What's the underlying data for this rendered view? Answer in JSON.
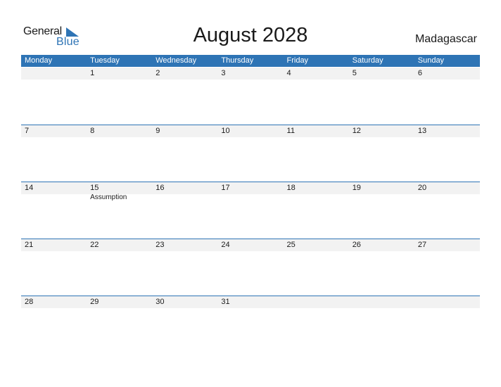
{
  "logo": {
    "general": "General",
    "blue": "Blue"
  },
  "title": "August 2028",
  "country": "Madagascar",
  "colors": {
    "accent": "#2e74b5",
    "stripe": "#f2f2f2"
  },
  "weekdays": [
    "Monday",
    "Tuesday",
    "Wednesday",
    "Thursday",
    "Friday",
    "Saturday",
    "Sunday"
  ],
  "weeks": [
    {
      "days": [
        {
          "num": "",
          "holiday": ""
        },
        {
          "num": "1",
          "holiday": ""
        },
        {
          "num": "2",
          "holiday": ""
        },
        {
          "num": "3",
          "holiday": ""
        },
        {
          "num": "4",
          "holiday": ""
        },
        {
          "num": "5",
          "holiday": ""
        },
        {
          "num": "6",
          "holiday": ""
        }
      ]
    },
    {
      "days": [
        {
          "num": "7",
          "holiday": ""
        },
        {
          "num": "8",
          "holiday": ""
        },
        {
          "num": "9",
          "holiday": ""
        },
        {
          "num": "10",
          "holiday": ""
        },
        {
          "num": "11",
          "holiday": ""
        },
        {
          "num": "12",
          "holiday": ""
        },
        {
          "num": "13",
          "holiday": ""
        }
      ]
    },
    {
      "days": [
        {
          "num": "14",
          "holiday": ""
        },
        {
          "num": "15",
          "holiday": "Assumption"
        },
        {
          "num": "16",
          "holiday": ""
        },
        {
          "num": "17",
          "holiday": ""
        },
        {
          "num": "18",
          "holiday": ""
        },
        {
          "num": "19",
          "holiday": ""
        },
        {
          "num": "20",
          "holiday": ""
        }
      ]
    },
    {
      "days": [
        {
          "num": "21",
          "holiday": ""
        },
        {
          "num": "22",
          "holiday": ""
        },
        {
          "num": "23",
          "holiday": ""
        },
        {
          "num": "24",
          "holiday": ""
        },
        {
          "num": "25",
          "holiday": ""
        },
        {
          "num": "26",
          "holiday": ""
        },
        {
          "num": "27",
          "holiday": ""
        }
      ]
    },
    {
      "days": [
        {
          "num": "28",
          "holiday": ""
        },
        {
          "num": "29",
          "holiday": ""
        },
        {
          "num": "30",
          "holiday": ""
        },
        {
          "num": "31",
          "holiday": ""
        },
        {
          "num": "",
          "holiday": ""
        },
        {
          "num": "",
          "holiday": ""
        },
        {
          "num": "",
          "holiday": ""
        }
      ]
    }
  ]
}
